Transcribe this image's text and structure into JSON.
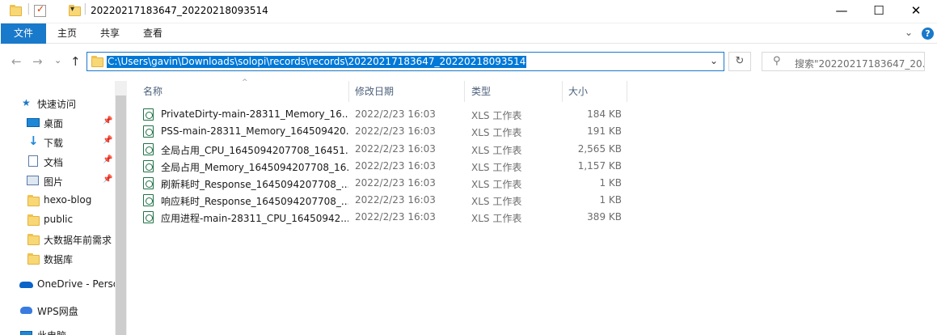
{
  "window": {
    "title": "20220217183647_20220218093514",
    "minimize": "—",
    "maximize": "☐",
    "close": "✕"
  },
  "ribbon": {
    "tabs": [
      "文件",
      "主页",
      "共享",
      "查看"
    ],
    "expand_glyph": "⌄",
    "help_glyph": "?"
  },
  "address": {
    "path": "C:\\Users\\gavin\\Downloads\\solopi\\records\\records\\20220217183647_20220218093514",
    "back_glyph": "←",
    "forward_glyph": "→",
    "recent_glyph": "⌄",
    "up_glyph": "↑",
    "dropdown_glyph": "⌄",
    "refresh_glyph": "↻"
  },
  "search": {
    "placeholder": "搜索\"20220217183647_20...",
    "icon_glyph": "⚲"
  },
  "nav": {
    "quick_access": "快速访问",
    "items": [
      {
        "label": "桌面",
        "icon": "desktop-icon",
        "pinned": true
      },
      {
        "label": "下载",
        "icon": "download-icon",
        "pinned": true
      },
      {
        "label": "文档",
        "icon": "document-icon",
        "pinned": true
      },
      {
        "label": "图片",
        "icon": "picture-icon",
        "pinned": true
      },
      {
        "label": "hexo-blog",
        "icon": "folder-icon",
        "pinned": false
      },
      {
        "label": "public",
        "icon": "folder-icon",
        "pinned": false
      },
      {
        "label": "大数据年前需求",
        "icon": "folder-icon",
        "pinned": false
      },
      {
        "label": "数据库",
        "icon": "folder-icon",
        "pinned": false
      }
    ],
    "onedrive": "OneDrive - Perso",
    "wps": "WPS网盘",
    "thispc": "此电脑"
  },
  "columns": {
    "name": "名称",
    "date": "修改日期",
    "type": "类型",
    "size": "大小"
  },
  "files": [
    {
      "name": "PrivateDirty-main-28311_Memory_16...",
      "date": "2022/2/23 16:03",
      "type": "XLS 工作表",
      "size": "184 KB"
    },
    {
      "name": "PSS-main-28311_Memory_164509420...",
      "date": "2022/2/23 16:03",
      "type": "XLS 工作表",
      "size": "191 KB"
    },
    {
      "name": "全局占用_CPU_1645094207708_16451...",
      "date": "2022/2/23 16:03",
      "type": "XLS 工作表",
      "size": "2,565 KB"
    },
    {
      "name": "全局占用_Memory_1645094207708_16...",
      "date": "2022/2/23 16:03",
      "type": "XLS 工作表",
      "size": "1,157 KB"
    },
    {
      "name": "刷新耗时_Response_1645094207708_...",
      "date": "2022/2/23 16:03",
      "type": "XLS 工作表",
      "size": "1 KB"
    },
    {
      "name": "响应耗时_Response_1645094207708_...",
      "date": "2022/2/23 16:03",
      "type": "XLS 工作表",
      "size": "1 KB"
    },
    {
      "name": "应用进程-main-28311_CPU_16450942...",
      "date": "2022/2/23 16:03",
      "type": "XLS 工作表",
      "size": "389 KB"
    }
  ],
  "colors": {
    "accent": "#1979ca",
    "selection": "#0078d7",
    "folder": "#f8d775"
  }
}
